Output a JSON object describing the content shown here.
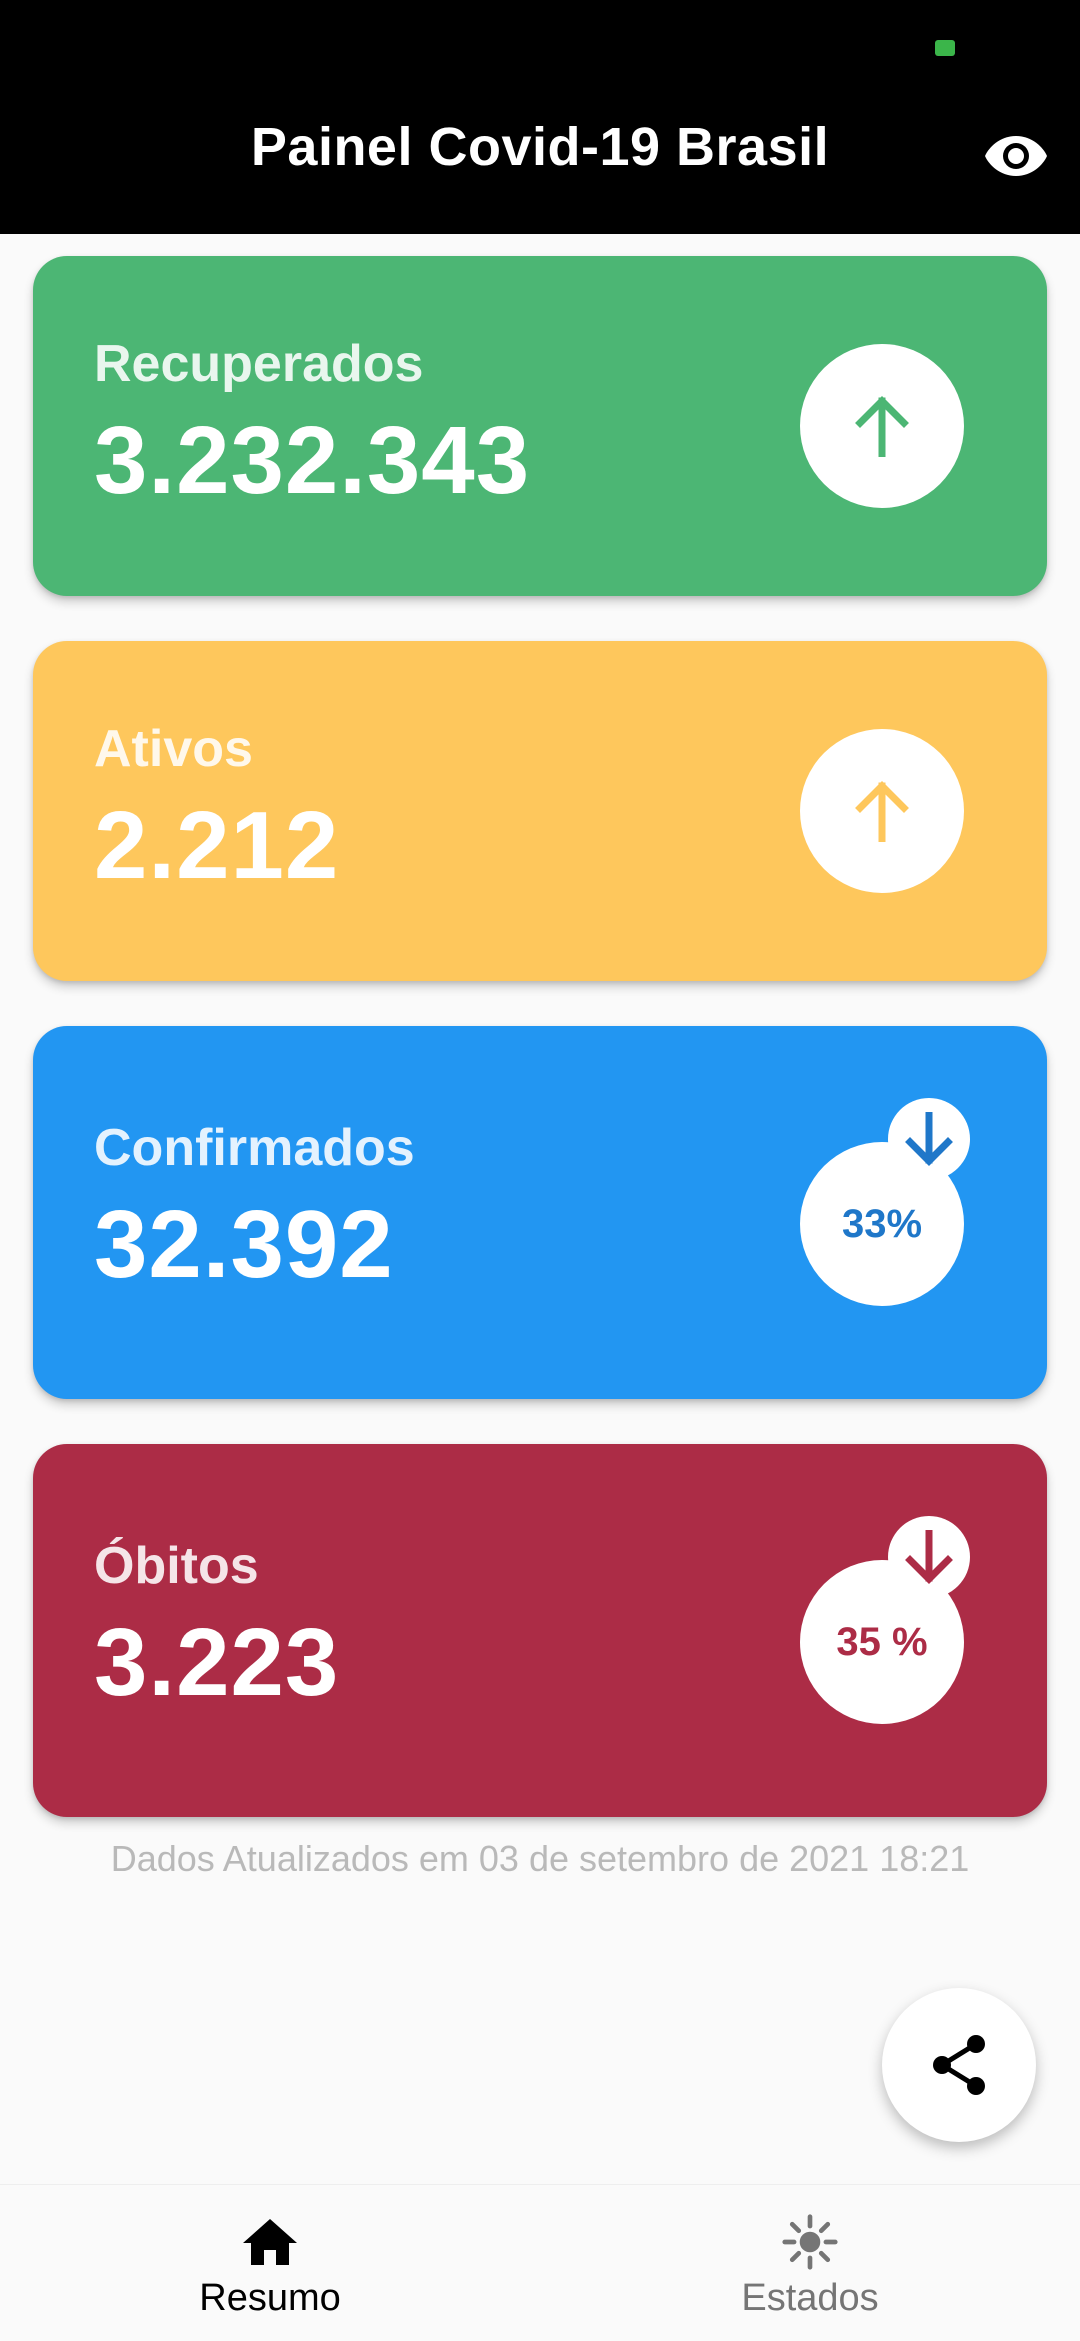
{
  "appbar": {
    "title": "Painel Covid-19 Brasil",
    "eye_icon": "eye-icon"
  },
  "cards": [
    {
      "label": "Recuperados",
      "value": "3.232.343",
      "color": "#4cb674",
      "trend": "up",
      "trend_icon": "arrow-up-icon",
      "icon_color": "#4cb674"
    },
    {
      "label": "Ativos",
      "value": "2.212",
      "color": "#fec75c",
      "trend": "up",
      "trend_icon": "arrow-up-icon",
      "icon_color": "#fec75c"
    },
    {
      "label": "Confirmados",
      "value": "32.392",
      "color": "#2296f2",
      "trend": "down",
      "trend_icon": "arrow-down-icon",
      "percent": "33%",
      "icon_color": "#1f77c9"
    },
    {
      "label": "Óbitos",
      "value": "3.223",
      "color": "#ac2c46",
      "trend": "down",
      "trend_icon": "arrow-down-icon",
      "percent": "35 %",
      "icon_color": "#ac2c46"
    }
  ],
  "updated_text": "Dados Atualizados em 03 de setembro de 2021 18:21",
  "fab": {
    "icon": "share-icon"
  },
  "bottom_nav": {
    "items": [
      {
        "label": "Resumo",
        "icon": "home-icon",
        "active": true
      },
      {
        "label": "Estados",
        "icon": "virus-icon",
        "active": false
      }
    ]
  }
}
